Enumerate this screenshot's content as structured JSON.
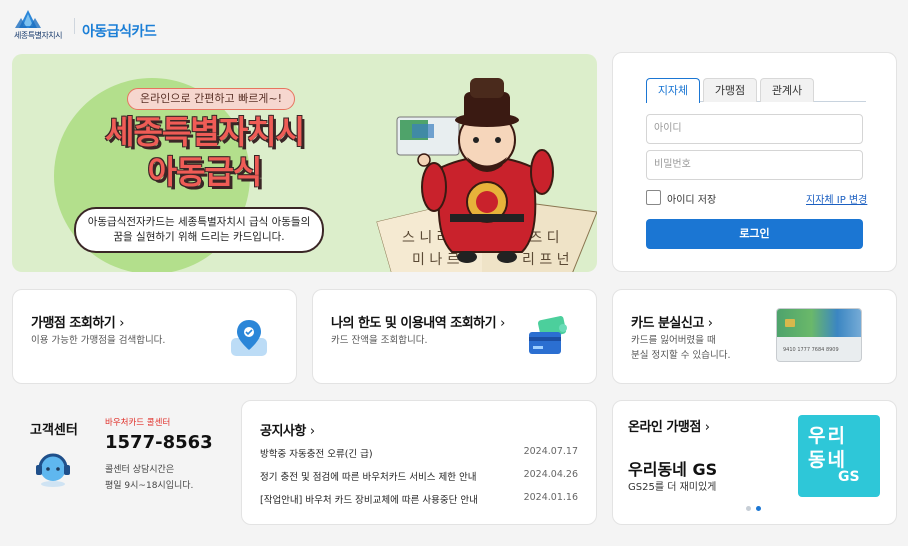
{
  "header": {
    "org_name": "세종특별자치시",
    "brand": "아동급식카드"
  },
  "banner": {
    "pill": "온라인으로 간편하고 빠르게~!",
    "headline_line1": "세종특별자치시",
    "headline_line2": "아동급식",
    "desc_line1": "아동급식전자카드는 세종특별자치시 급식 아동들의",
    "desc_line2": "꿈을 실현하기 위해 드리는 카드입니다."
  },
  "login": {
    "tabs": [
      {
        "label": "지자체",
        "active": true
      },
      {
        "label": "가맹점",
        "active": false
      },
      {
        "label": "관계사",
        "active": false
      }
    ],
    "id_placeholder": "아이디",
    "pw_placeholder": "비밀번호",
    "save_id_label": "아이디 저장",
    "ip_change_link": "지자체 IP 변경",
    "login_button": "로그인"
  },
  "quick_cards": [
    {
      "title": "가맹점 조회하기",
      "sub": "이용 가능한 가맹점을 검색합니다.",
      "icon": "map-pin-icon"
    },
    {
      "title": "나의 한도 및 이용내역 조회하기",
      "sub": "카드 잔액을 조회합니다.",
      "icon": "card-balance-icon"
    },
    {
      "title": "카드 분실신고",
      "sub_line1": "카드를 잃어버렸을 때",
      "sub_line2": "분실 정지할 수 있습니다.",
      "icon": "card-image",
      "card_number": "9410 1777 7684 8909"
    }
  ],
  "support": {
    "title": "고객센터",
    "voucher_label": "바우처카드 콜센터",
    "phone": "1577-8563",
    "hours_line1": "콜센터 상담시간은",
    "hours_line2": "평일 9시~18시입니다."
  },
  "notices": {
    "title": "공지사항",
    "items": [
      {
        "text": "방학중 자동충전 오류(긴 급)",
        "date": "2024.07.17"
      },
      {
        "text": "정기 충전 및 점검에 따른 바우처카드 서비스 제한 안내",
        "date": "2024.04.26"
      },
      {
        "text": "[작업안내] 바우처 카드 장비교체에 따른 사용중단 안내",
        "date": "2024.01.16"
      }
    ]
  },
  "online_store": {
    "title": "온라인 가맹점",
    "store_name": "우리동네 GS",
    "store_sub": "GS25를 더 재미있게",
    "logo_text": [
      "우리",
      "동네",
      "GS"
    ],
    "carousel_total": 2,
    "carousel_active": 2
  },
  "colors": {
    "brand_blue": "#1b76d3",
    "accent_red": "#ef5c56",
    "banner_bg": "#dceecb",
    "gs_teal": "#2ec7d8"
  }
}
